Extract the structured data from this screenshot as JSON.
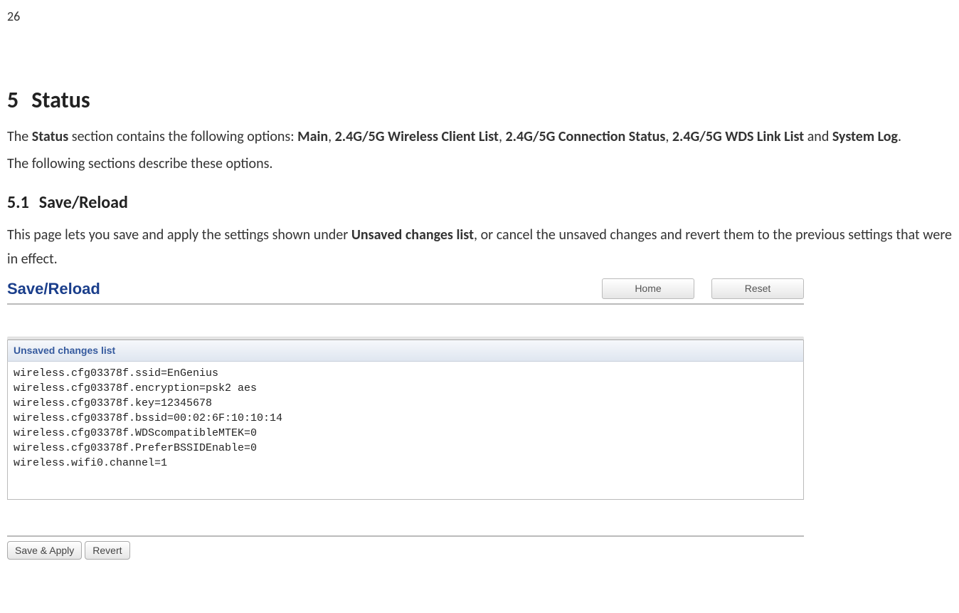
{
  "page": {
    "number": "26"
  },
  "doc": {
    "h1_num": "5",
    "h1_title": "Status",
    "p1_pre": "The ",
    "p1_b1": "Status",
    "p1_mid1": " section contains the following options: ",
    "p1_b2": "Main",
    "p1_c1": ", ",
    "p1_b3": "2.4G/5G Wireless Client List",
    "p1_c2": ", ",
    "p1_b4": "2.4G/5G Connection Status",
    "p1_c3": ", ",
    "p1_b5": "2.4G/5G WDS Link List",
    "p1_and": " and ",
    "p1_b6": "System Log",
    "p1_end": ".",
    "p2": "The following sections describe these options.",
    "h2_num": "5.1",
    "h2_title": "Save/Reload",
    "p3_pre": "This page lets you save and apply the settings shown under ",
    "p3_b1": "Unsaved changes list",
    "p3_post": ", or cancel the unsaved changes and revert them to the previous settings that were in effect."
  },
  "ui": {
    "title": "Save/Reload",
    "buttons": {
      "home": "Home",
      "reset": "Reset"
    },
    "legend": "Unsaved changes list",
    "changes": "wireless.cfg03378f.ssid=EnGenius\nwireless.cfg03378f.encryption=psk2 aes\nwireless.cfg03378f.key=12345678\nwireless.cfg03378f.bssid=00:02:6F:10:10:14\nwireless.cfg03378f.WDScompatibleMTEK=0\nwireless.cfg03378f.PreferBSSIDEnable=0\nwireless.wifi0.channel=1",
    "actions": {
      "save": "Save & Apply",
      "revert": "Revert"
    }
  }
}
